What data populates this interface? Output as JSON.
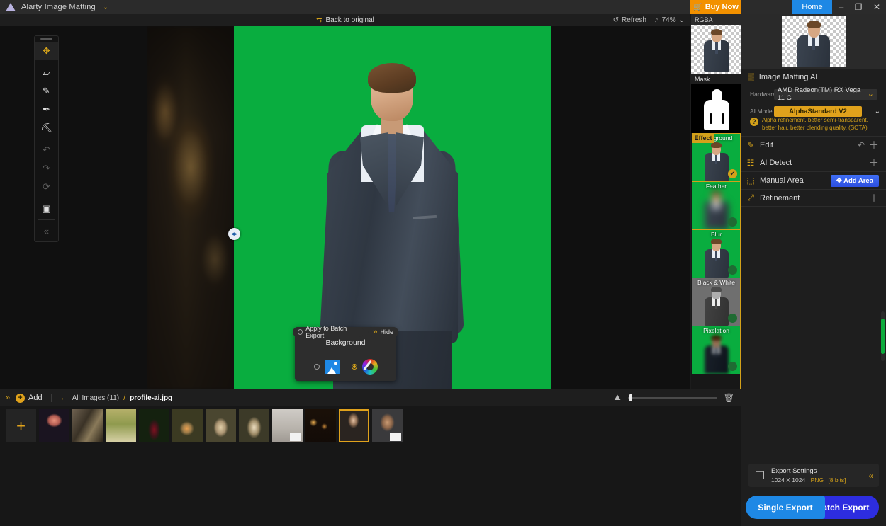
{
  "titlebar": {
    "app_title": "Alarty Image Matting",
    "caret": "⌄",
    "buy_now": "Buy Now",
    "cart_icon": "🛒",
    "home": "Home",
    "minimize": "–",
    "maximize": "❐",
    "close": "✕"
  },
  "canvas_toolbar": {
    "back_to_original": "Back to original",
    "swap_icon": "⇆",
    "refresh": "Refresh",
    "refresh_icon": "↺",
    "zoom_icon": "⌕",
    "zoom_level": "74%",
    "zoom_caret": "⌄"
  },
  "tools": [
    {
      "name": "move-tool",
      "glyph": "✥",
      "active": true
    },
    {
      "name": "eraser-tool",
      "glyph": "▱",
      "active": false
    },
    {
      "name": "pen-tool",
      "glyph": "✎",
      "active": false
    },
    {
      "name": "brush-tool",
      "glyph": "✒",
      "active": false
    },
    {
      "name": "roller-tool",
      "glyph": "⛏",
      "active": false
    },
    {
      "name": "undo-tool",
      "glyph": "↶",
      "active": false
    },
    {
      "name": "redo-tool",
      "glyph": "↷",
      "active": false
    },
    {
      "name": "reset-tool",
      "glyph": "⟳",
      "active": false
    },
    {
      "name": "crop-tool",
      "glyph": "▣",
      "active": false
    },
    {
      "name": "collapse-tools",
      "glyph": "«",
      "active": false
    }
  ],
  "preview_strip": {
    "rgba_label": "RGBA",
    "mask_label": "Mask"
  },
  "effects": {
    "tab_label": "Effect",
    "items": [
      {
        "label": "Background",
        "selected": true
      },
      {
        "label": "Feather",
        "selected": false
      },
      {
        "label": "Blur",
        "selected": false
      },
      {
        "label": "Black & White",
        "selected": false
      },
      {
        "label": "Pixelation",
        "selected": false
      }
    ],
    "check_glyph": "✔"
  },
  "right_panel": {
    "section_title": "Image Matting AI",
    "section_icon": "▒",
    "hardware_label": "Hardware",
    "hardware_value": "AMD Radeon(TM) RX Vega 11 G",
    "ai_model_label": "AI Model",
    "ai_model_value": "AlphaStandard  V2",
    "caret": "⌄",
    "hint_mark": "?",
    "hint_text": "Alpha refinement, better semi-transparent, better hair, better blending quality. (SOTA)",
    "rows": [
      {
        "name": "edit",
        "icon": "✎",
        "label": "Edit",
        "undo": "↶",
        "action": "＋"
      },
      {
        "name": "ai-detect",
        "icon": "☷",
        "label": "AI Detect",
        "undo": "",
        "action": "＋"
      },
      {
        "name": "manual-area",
        "icon": "⬚",
        "label": "Manual Area",
        "undo": "",
        "action": "",
        "button": "✥ Add Area"
      },
      {
        "name": "refinement",
        "icon": "⤢",
        "label": "Refinement",
        "undo": "",
        "action": "＋"
      }
    ]
  },
  "background_popup": {
    "apply_batch_label": "Apply to Batch Export",
    "apply_batch_selected": false,
    "hide_label": "Hide",
    "hide_icon": "»",
    "title": "Background",
    "option_image_selected": false,
    "option_color_selected": true
  },
  "filmstrip_bar": {
    "collapse_icon": "»",
    "add_label": "Add",
    "add_icon": "+",
    "back_arrow": "←",
    "all_images": "All Images (11)",
    "separator": "/",
    "current_file": "profile-ai.jpg",
    "thumb_size_icon": "⛰",
    "trash_icon": "🗑"
  },
  "thumbnails": [
    {
      "name": "add-image",
      "kind": "add",
      "glyph": "+"
    },
    {
      "name": "thumb-jellyfish",
      "kind": "image",
      "selected": false,
      "overlay": false
    },
    {
      "name": "thumb-fantasy-art",
      "kind": "image",
      "selected": false,
      "overlay": false
    },
    {
      "name": "thumb-bicycle",
      "kind": "image",
      "selected": false,
      "overlay": false
    },
    {
      "name": "thumb-red-dress",
      "kind": "image",
      "selected": false,
      "overlay": false
    },
    {
      "name": "thumb-bride-flowers",
      "kind": "image",
      "selected": false,
      "overlay": false
    },
    {
      "name": "thumb-woman-garden",
      "kind": "image",
      "selected": false,
      "overlay": false
    },
    {
      "name": "thumb-woman-portrait",
      "kind": "image",
      "selected": false,
      "overlay": false
    },
    {
      "name": "thumb-blonde-studio",
      "kind": "image",
      "selected": false,
      "overlay": true
    },
    {
      "name": "thumb-night-lights",
      "kind": "image",
      "selected": false,
      "overlay": false
    },
    {
      "name": "thumb-profile-ai",
      "kind": "image",
      "selected": true,
      "overlay": false
    },
    {
      "name": "thumb-bearded-man",
      "kind": "image",
      "selected": false,
      "overlay": true
    }
  ],
  "export": {
    "icon": "❐",
    "title": "Export Settings",
    "dimensions": "1024 X 1024",
    "format": "PNG",
    "bits": "[8 bits]",
    "chev": "«",
    "single_label": "Single Export",
    "batch_label": "Batch Export"
  },
  "colors": {
    "accent_gold": "#d3a11a",
    "buy_now_orange": "#f29100",
    "home_blue": "#1e88e5",
    "green_screen": "#09ad3f",
    "add_area_blue": "#2d4fe0",
    "batch_indigo": "#2d2de0"
  }
}
